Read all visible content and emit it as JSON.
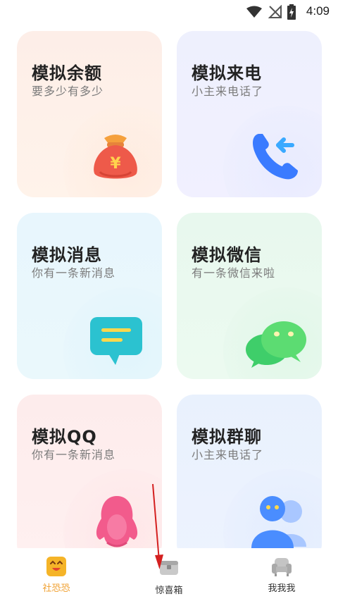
{
  "status_bar": {
    "time": "4:09"
  },
  "cards": [
    {
      "title": "模拟余额",
      "subtitle": "要多少有多少",
      "icon": "money-bag-icon"
    },
    {
      "title": "模拟来电",
      "subtitle": "小主来电话了",
      "icon": "phone-call-icon"
    },
    {
      "title": "模拟消息",
      "subtitle": "你有一条新消息",
      "icon": "message-bubble-icon"
    },
    {
      "title": "模拟微信",
      "subtitle": "有一条微信来啦",
      "icon": "wechat-icon"
    },
    {
      "title": "模拟QQ",
      "subtitle": "你有一条新消息",
      "icon": "qq-penguin-icon"
    },
    {
      "title": "模拟群聊",
      "subtitle": "小主来电话了",
      "icon": "group-chat-icon"
    }
  ],
  "tabs": [
    {
      "label": "社恐恐",
      "icon": "happy-face-icon",
      "active": true
    },
    {
      "label": "惊喜箱",
      "icon": "gift-box-icon",
      "active": false
    },
    {
      "label": "我我我",
      "icon": "armchair-icon",
      "active": false
    }
  ],
  "colors": {
    "active_tab": "#f0a030",
    "text_primary": "#222222",
    "text_secondary": "#7b7b7b",
    "annotation_arrow": "#d42020"
  }
}
